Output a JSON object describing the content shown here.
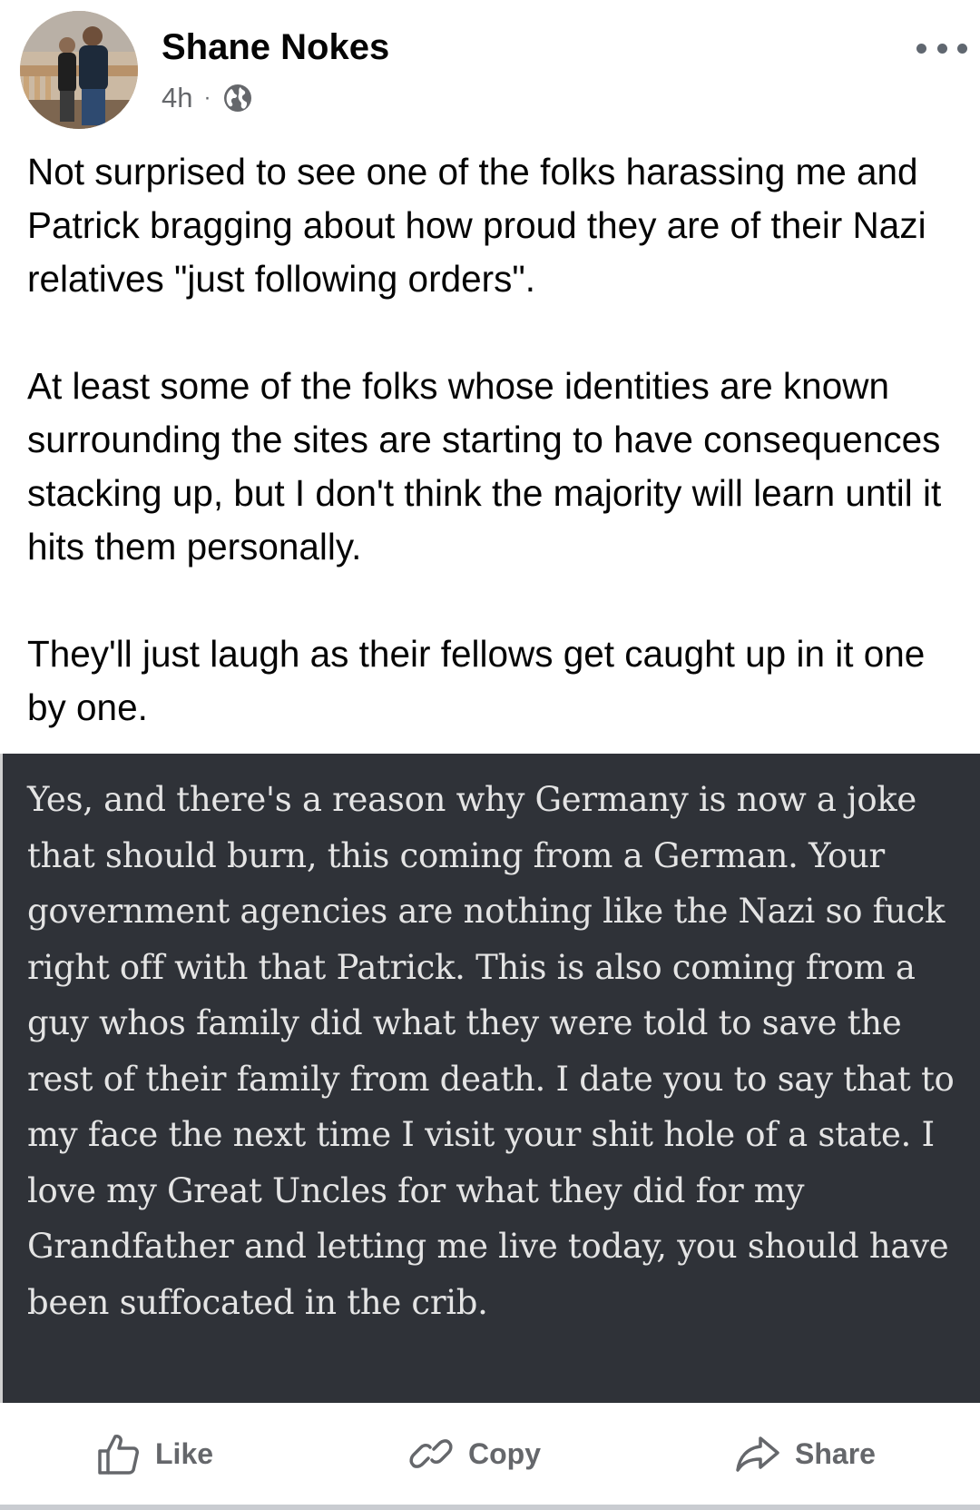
{
  "post": {
    "author": "Shane Nokes",
    "time": "4h",
    "separator": "·",
    "paragraphs": [
      "Not surprised to see one of the folks harassing me and Patrick bragging about how proud they are of their Nazi relatives \"just following orders\".",
      "At least some of the folks whose identities are known surrounding the sites are starting to have consequences stacking up, but I don't think the majority will learn until it hits them personally.",
      "They'll just laugh as their fellows get caught up in it one by one."
    ],
    "image_text": "Yes, and there's a reason why Germany is now a joke that should burn, this coming from a German. Your government agencies are nothing like the Nazi so fuck right off with that Patrick. This is also coming from a guy whos family did what they were told to save the rest of their family from death. I date you to say that to my face the next time I visit your shit hole of a state. I love my Great Uncles for what they did for my Grandfather and letting me live today, you should have been suffocated in the crib."
  },
  "actions": {
    "like": "Like",
    "copy": "Copy",
    "share": "Share"
  },
  "icons": {
    "more": "more-options-icon",
    "audience": "globe-icon",
    "like": "thumbs-up-icon",
    "copy": "link-icon",
    "share": "share-arrow-icon"
  },
  "colors": {
    "text": "#050505",
    "secondary": "#65676b",
    "image_background": "#2f3238",
    "image_text": "#e4e4e4"
  }
}
